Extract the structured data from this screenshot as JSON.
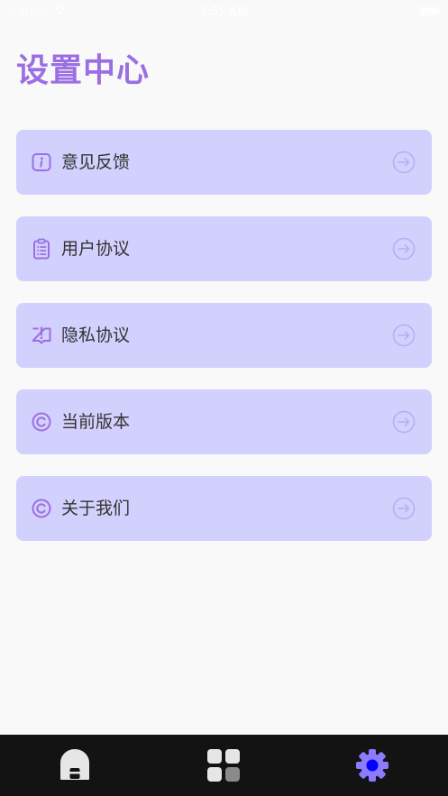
{
  "status_bar": {
    "carrier": "Carrier",
    "time": "3:51 AM"
  },
  "page": {
    "title": "设置中心"
  },
  "settings_items": [
    {
      "label": "意见反馈",
      "icon": "info-icon"
    },
    {
      "label": "用户协议",
      "icon": "clipboard-icon"
    },
    {
      "label": "隐私协议",
      "icon": "privacy-alert-icon"
    },
    {
      "label": "当前版本",
      "icon": "copyright-icon"
    },
    {
      "label": "关于我们",
      "icon": "copyright-icon"
    }
  ],
  "arrow_icon": "arrow-right-circle-icon",
  "tab_bar": {
    "items": [
      {
        "icon": "home-icon",
        "active": false
      },
      {
        "icon": "apps-grid-icon",
        "active": false
      },
      {
        "icon": "settings-gear-icon",
        "active": true
      }
    ]
  },
  "colors": {
    "accent": "#9b6fe3",
    "card_background": "#d2d0fd",
    "page_background": "#f9f9f9",
    "tab_bar_background": "#131313",
    "active_tab_icon": "#8b7bff",
    "active_tab_dot": "#0000ff",
    "inactive_tab_icon": "#e6e6e6"
  }
}
